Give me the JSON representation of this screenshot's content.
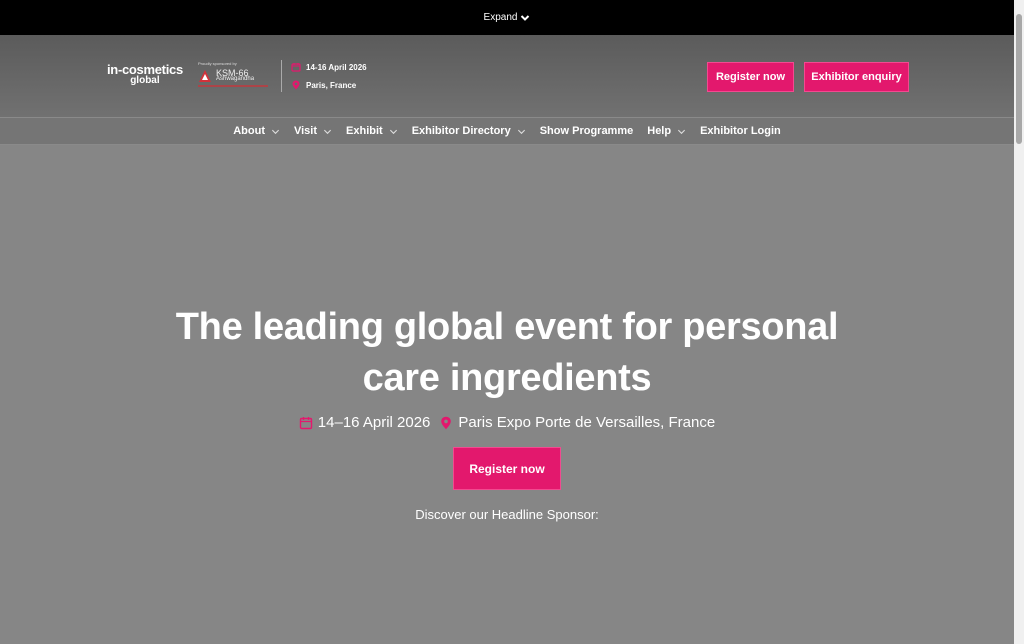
{
  "topbar": {
    "expand_label": "Expand"
  },
  "header": {
    "logo_line1": "in-cosmetics",
    "logo_line2": "global",
    "sponsor_small": "Proudly sponsored by",
    "sponsor_name": "KSM-66",
    "sponsor_sub": "Ashwagandha",
    "date": "14-16 April 2026",
    "location": "Paris, France",
    "register_label": "Register now",
    "exhibitor_label": "Exhibitor enquiry"
  },
  "nav": {
    "items": [
      {
        "label": "About"
      },
      {
        "label": "Visit"
      },
      {
        "label": "Exhibit"
      },
      {
        "label": "Exhibitor Directory"
      },
      {
        "label": "Show Programme"
      },
      {
        "label": "Help"
      },
      {
        "label": "Exhibitor Login"
      }
    ]
  },
  "hero": {
    "title_line1": "The leading global event for personal",
    "title_line2": "care ingredients",
    "date": "14–16 April 2026",
    "venue": "Paris Expo Porte de Versailles, France",
    "register_label": "Register now",
    "discover_text": "Discover our Headline Sponsor:"
  },
  "colors": {
    "accent": "#e3186d",
    "topbar": "#000000",
    "hero_bg": "#868686"
  }
}
